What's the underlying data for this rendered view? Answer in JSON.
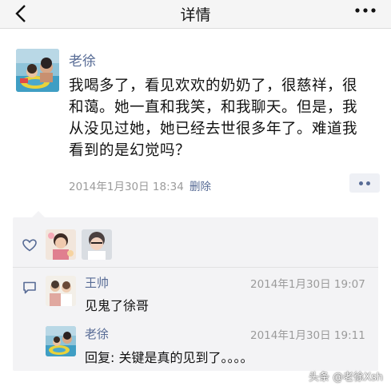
{
  "nav": {
    "title": "详情",
    "back_icon": "chevron-left-icon",
    "more_icon": "more-dots-icon"
  },
  "post": {
    "author": "老徐",
    "text": "我喝多了，看见欢欢的奶奶了，很慈祥，很和蔼。她一直和我笑，和我聊天。但是，我从没见过她，她已经去世很多年了。难道我看到的是幻觉吗？",
    "time": "2014年1月30日 18:34",
    "delete_label": "删除"
  },
  "likes": {
    "icon": "heart-icon"
  },
  "comments": [
    {
      "name": "王帅",
      "time": "2014年1月30日 19:07",
      "text": "见鬼了徐哥"
    },
    {
      "name": "老徐",
      "time": "2014年1月30日 19:11",
      "text": "回复: 关键是真的见到了。。。。"
    }
  ],
  "watermark": "头条 @老徐Xsh",
  "colors": {
    "link": "#576b95",
    "panel": "#f3f3f5",
    "nav_bg": "#f5f5f5",
    "muted": "#9b9b9b"
  }
}
